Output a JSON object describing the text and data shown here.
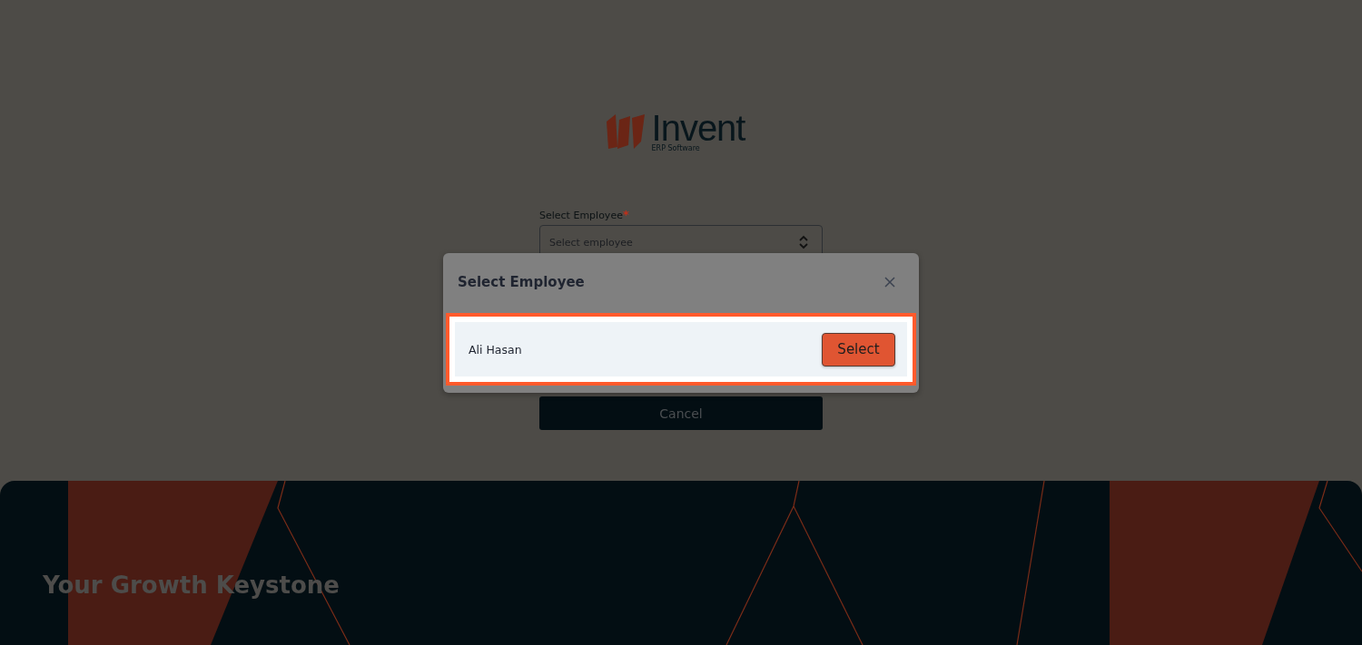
{
  "logo": {
    "name": "Invent",
    "tagline": "ERP Software"
  },
  "form": {
    "label": "Select Employee",
    "required_mark": "*",
    "field": {
      "placeholder": "Select employee"
    },
    "cancel_button": "Cancel"
  },
  "modal": {
    "title": "Select Employee",
    "employees": [
      {
        "name": "Ali Hasan",
        "action": "Select",
        "highlighted": true
      }
    ]
  },
  "banner": {
    "slogan": "Your Growth Keystone"
  }
}
